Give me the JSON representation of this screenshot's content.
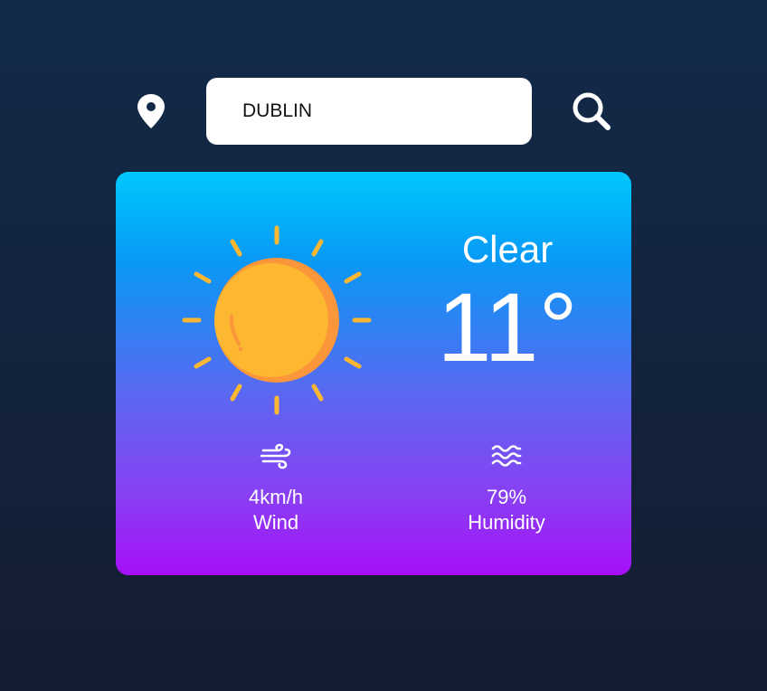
{
  "search": {
    "value": "DUBLIN",
    "location_icon": "map-pin-icon",
    "search_icon": "magnifier-icon"
  },
  "weather": {
    "icon": "sun-icon",
    "condition": "Clear",
    "temperature": "11°",
    "wind": {
      "icon": "wind-icon",
      "value": "4km/h",
      "label": "Wind"
    },
    "humidity": {
      "icon": "waves-icon",
      "value": "79%",
      "label": "Humidity"
    }
  },
  "colors": {
    "background_top": "#122a49",
    "background_bottom": "#141d31",
    "card_top": "#00c8fc",
    "card_bottom": "#a60ff8",
    "sun": "#fdb730",
    "sun_shadow": "#fb963a"
  }
}
